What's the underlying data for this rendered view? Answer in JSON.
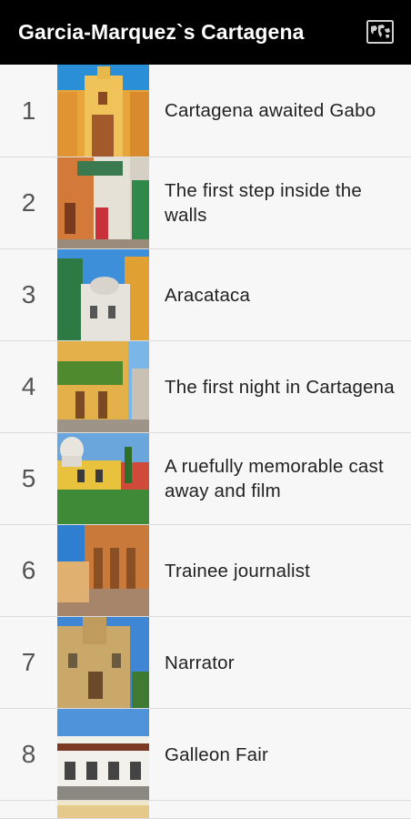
{
  "app": {
    "title": "Garcia-Marquez`s Cartagena",
    "map_icon": "world-map-icon"
  },
  "items": [
    {
      "num": "1",
      "title": "Cartagena awaited Gabo"
    },
    {
      "num": "2",
      "title": "The first step inside the walls"
    },
    {
      "num": "3",
      "title": "Aracataca"
    },
    {
      "num": "4",
      "title": "The first night in Cartagena"
    },
    {
      "num": "5",
      "title": "A ruefully memorable cast away and film"
    },
    {
      "num": "6",
      "title": "Trainee journalist"
    },
    {
      "num": "7",
      "title": "Narrator"
    },
    {
      "num": "8",
      "title": "Galleon Fair"
    }
  ],
  "colors": {
    "appbar": "#000000",
    "row_bg": "#f7f7f7",
    "divider": "#dcdcdc"
  }
}
